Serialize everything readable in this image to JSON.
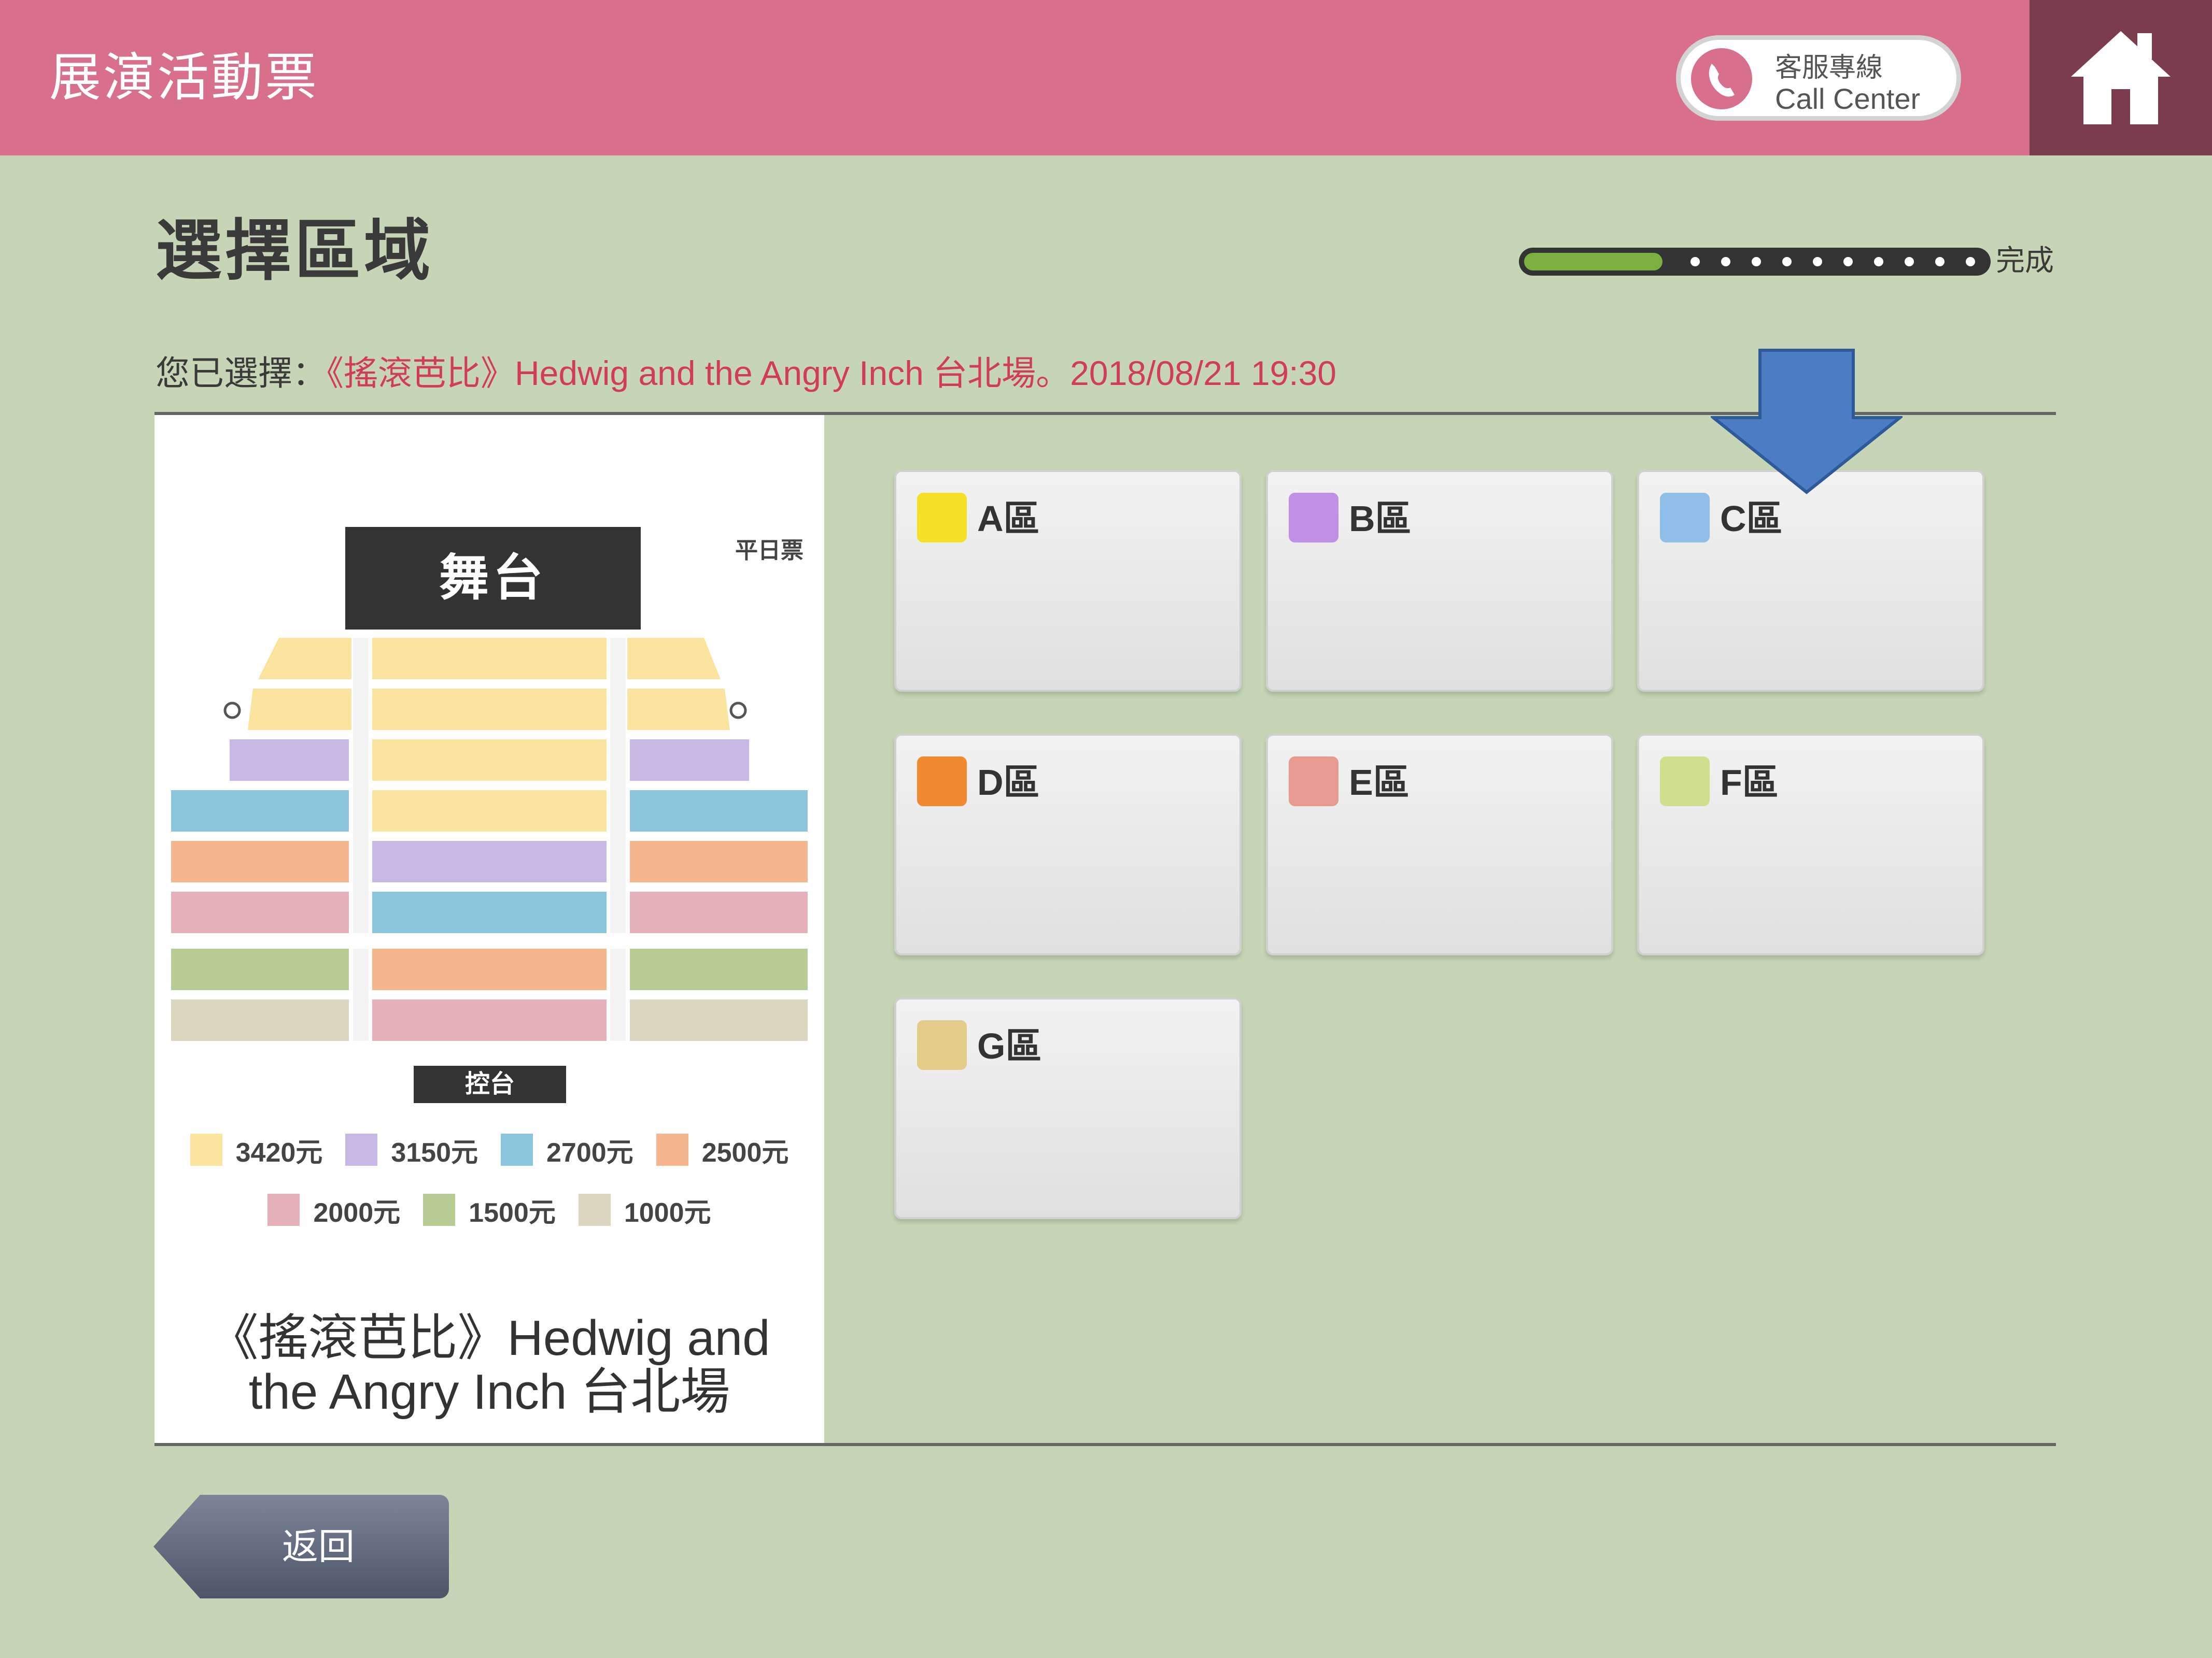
{
  "header": {
    "title": "展演活動票",
    "call_center_line1": "客服專線",
    "call_center_line2": "Call Center"
  },
  "page": {
    "title": "選擇區域",
    "progress_end_label": "完成",
    "progress_fraction": 0.3
  },
  "selection": {
    "prefix": "您已選擇：",
    "value": "《搖滾芭比》Hedwig and the Angry Inch 台北場。2018/08/21 19:30"
  },
  "seat_map": {
    "stage_label": "舞台",
    "weekday_label": "平日票",
    "control_label": "控台",
    "legend": [
      {
        "price": "3420元",
        "color": "#fbe49e"
      },
      {
        "price": "3150元",
        "color": "#c9b8e6"
      },
      {
        "price": "2700元",
        "color": "#8cc6dc"
      },
      {
        "price": "2500元",
        "color": "#f6b690"
      },
      {
        "price": "2000元",
        "color": "#e6b0b8"
      },
      {
        "price": "1500元",
        "color": "#b6cc92"
      },
      {
        "price": "1000元",
        "color": "#dcd6c0"
      }
    ],
    "event_name_line1": "《搖滾芭比》Hedwig and",
    "event_name_line2": "the Angry Inch 台北場"
  },
  "zones": [
    {
      "label": "A區",
      "color": "#f5e028"
    },
    {
      "label": "B區",
      "color": "#c28fe6"
    },
    {
      "label": "C區",
      "color": "#8fbfe8"
    },
    {
      "label": "D區",
      "color": "#f08a30"
    },
    {
      "label": "E區",
      "color": "#e69a90"
    },
    {
      "label": "F區",
      "color": "#cee08e"
    },
    {
      "label": "G區",
      "color": "#e2cc88"
    }
  ],
  "back_button": {
    "label": "返回"
  },
  "colors": {
    "header_bg": "#d8708c",
    "home_bg": "#7b3d4d",
    "page_bg": "#c5d5b6",
    "selected_text": "#d03c5a",
    "progress_fill": "#7ab040",
    "arrow": "#4c7cc4"
  }
}
